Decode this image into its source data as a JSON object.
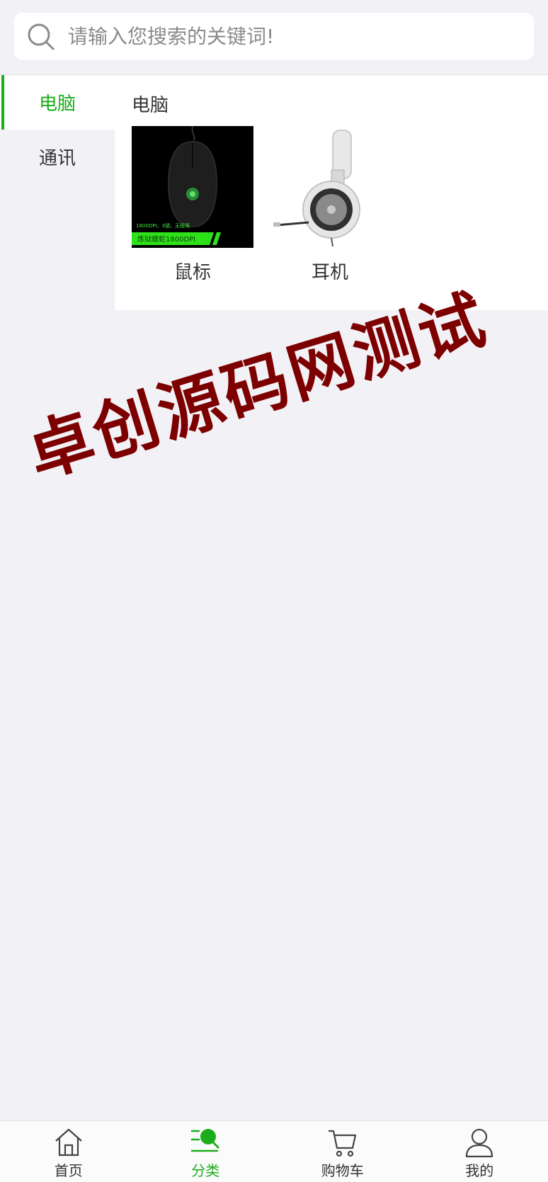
{
  "search": {
    "placeholder": "请输入您搜索的关键词!"
  },
  "sidebar": {
    "items": [
      {
        "label": "电脑",
        "active": true
      },
      {
        "label": "通讯",
        "active": false
      }
    ]
  },
  "content": {
    "category_title": "电脑",
    "products": [
      {
        "name": "鼠标",
        "thumb_text_1": "1800DPI，3键，无极限",
        "thumb_text_2": "炼狱蝰蛇1800DPI"
      },
      {
        "name": "耳机"
      }
    ]
  },
  "watermark": {
    "text": "卓创源码网测试"
  },
  "tabbar": {
    "items": [
      {
        "label": "首页",
        "icon": "home-icon",
        "active": false
      },
      {
        "label": "分类",
        "icon": "category-icon",
        "active": true
      },
      {
        "label": "购物车",
        "icon": "cart-icon",
        "active": false
      },
      {
        "label": "我的",
        "icon": "user-icon",
        "active": false
      }
    ]
  },
  "colors": {
    "accent": "#1aad19",
    "watermark": "#7d0000",
    "background": "#f2f1f6"
  }
}
